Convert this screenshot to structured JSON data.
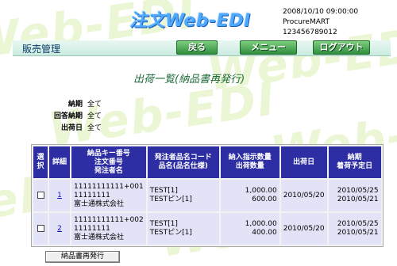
{
  "header": {
    "logo_text": "注文Web-EDI",
    "datetime": "2008/10/10 09:00:00",
    "company": "ProcureMART",
    "user_code": "123456789012"
  },
  "menubar": {
    "title": "販売管理",
    "buttons": {
      "back": "戻る",
      "menu": "メニュー",
      "logout": "ログアウト"
    }
  },
  "page": {
    "heading": "出荷一覧(納品書再発行)"
  },
  "criteria": [
    {
      "label": "納期",
      "value": "全て"
    },
    {
      "label": "回答納期",
      "value": "全て"
    },
    {
      "label": "出荷日",
      "value": "全て"
    }
  ],
  "table": {
    "headers": {
      "select": "選択",
      "detail": "詳細",
      "keys_1": "納品キー番号",
      "keys_2": "注文番号",
      "keys_3": "発注者名",
      "item_1": "発注者品名コード",
      "item_2": "品名(品名仕様)",
      "qty_1": "納入指示数量",
      "qty_2": "出荷数量",
      "ship_date": "出荷日",
      "due_1": "納期",
      "due_2": "着荷予定日"
    },
    "rows": [
      {
        "detail": "1",
        "key": "11111111111+001",
        "order_no": "11111111",
        "orderer": "富士通株式会社",
        "item_code": "TEST[1]",
        "item_name": "TESTピン[1]",
        "qty_instructed": "1,000.00",
        "qty_shipped": "600.00",
        "ship_date": "2010/05/20",
        "due_date": "2010/05/25",
        "arrival_date": "2010/05/21"
      },
      {
        "detail": "2",
        "key": "11111111111+002",
        "order_no": "11111111",
        "orderer": "富士通株式会社",
        "item_code": "TEST[1]",
        "item_name": "TESTピン[1]",
        "qty_instructed": "1,000.00",
        "qty_shipped": "400.00",
        "ship_date": "2010/05/20",
        "due_date": "2010/05/25",
        "arrival_date": "2010/05/21"
      }
    ]
  },
  "actions": {
    "reissue": "納品書再発行"
  },
  "colors": {
    "header_bg": "#2d2da4",
    "cell_bg": "#e3e3f7",
    "heading_green": "#1e6b3a",
    "button_green": "#2f8f3f",
    "logo_blue": "#4fa9ff"
  },
  "watermark": {
    "text": "Web-EDI"
  }
}
